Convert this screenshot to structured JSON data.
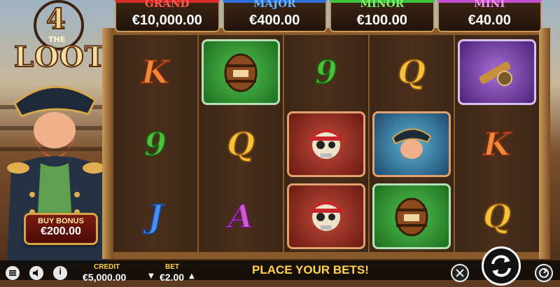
{
  "logo": {
    "number": "4",
    "the": "THE",
    "name": "LOOT"
  },
  "jackpots": [
    {
      "name": "GRAND",
      "value": "€10,000.00",
      "color": "#d62b2b"
    },
    {
      "name": "MAJOR",
      "value": "€400.00",
      "color": "#2c6fd6"
    },
    {
      "name": "MINOR",
      "value": "€100.00",
      "color": "#3cc43c"
    },
    {
      "name": "MINI",
      "value": "€40.00",
      "color": "#c24fd0"
    }
  ],
  "reels": [
    [
      "K",
      "9",
      "J"
    ],
    [
      "barrel-tile",
      "Q",
      "A"
    ],
    [
      "9",
      "skull-tile",
      "skull-tile"
    ],
    [
      "Q",
      "captain-tile",
      "barrel-tile"
    ],
    [
      "spyglass-tile",
      "K",
      "Q"
    ]
  ],
  "buy_bonus": {
    "label": "BUY BONUS",
    "price": "€200.00"
  },
  "status_bar": {
    "credit_label": "CREDIT",
    "credit_value": "€5,000.00",
    "bet_label": "BET",
    "bet_value": "€2.00",
    "message": "PLACE YOUR BETS!",
    "info_glyph": "i"
  }
}
